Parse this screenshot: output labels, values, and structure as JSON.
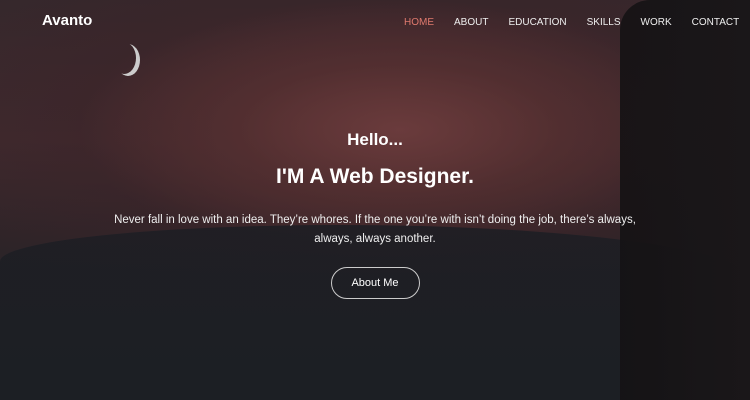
{
  "brand": "Avanto",
  "nav": [
    "HOME",
    "ABOUT",
    "EDUCATION",
    "SKILLS",
    "WORK",
    "CONTACT"
  ],
  "hero": {
    "greeting": "Hello...",
    "title": "I'M A Web Designer.",
    "description": "Never fall in love with an idea. They’re whores. If the one you’re with isn’t doing the job, there’s always, always, always another.",
    "button": "About Me"
  },
  "colors": {
    "accent": "#e07a6e"
  }
}
